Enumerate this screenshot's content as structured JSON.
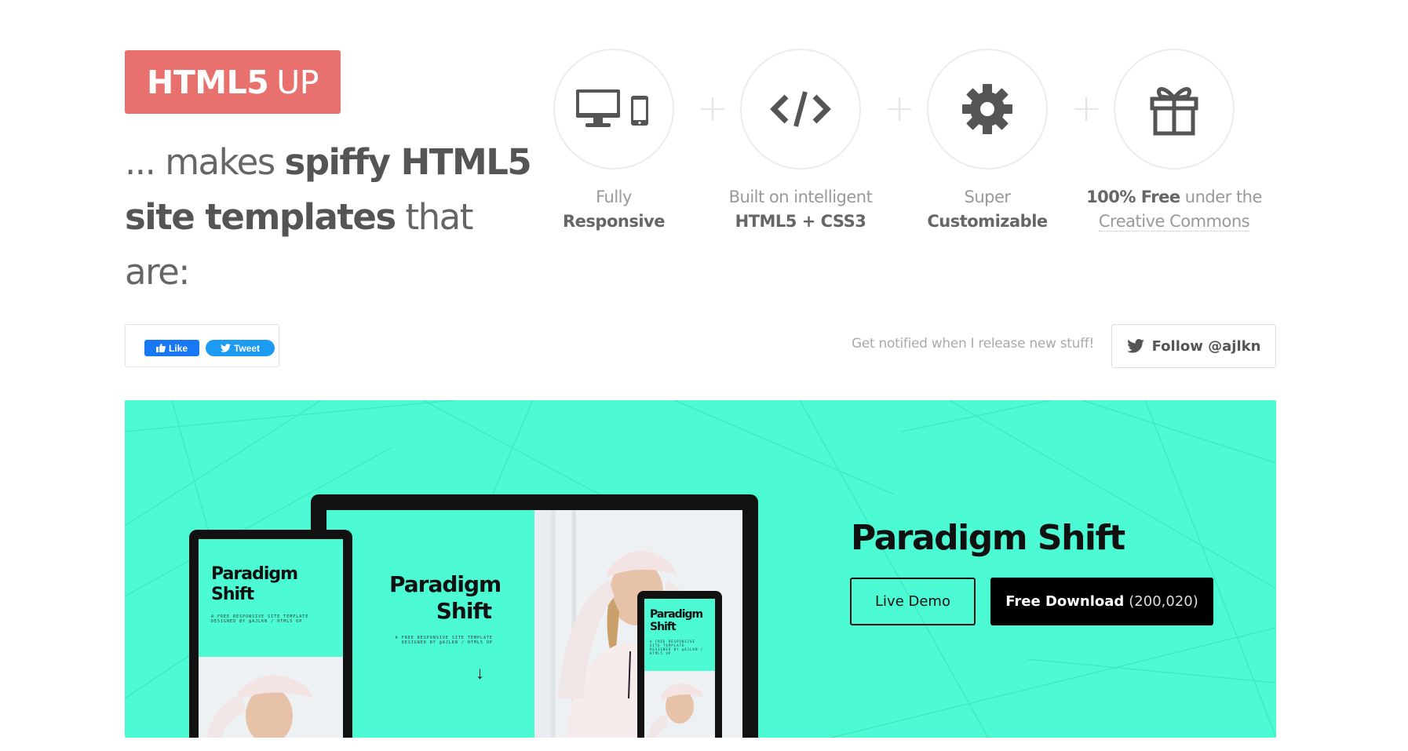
{
  "logo": {
    "bold": "HTML5",
    "light": "UP"
  },
  "tagline": {
    "p1": "... makes ",
    "b1": "spiffy HTML5",
    "b2": "site templates",
    "p2": " that are:"
  },
  "features": [
    {
      "icon": "devices-icon",
      "line1": "Fully",
      "line2": "Responsive"
    },
    {
      "icon": "code-icon",
      "line1": "Built on intelligent",
      "line2": "HTML5 + CSS3"
    },
    {
      "icon": "gear-icon",
      "line1": "Super",
      "line2": "Customizable"
    },
    {
      "icon": "gift-icon",
      "line1_bold": "100% Free",
      "line1_rest": " under the",
      "line2": "Creative Commons"
    }
  ],
  "social": {
    "like_label": "Like",
    "tweet_label": "Tweet"
  },
  "notify_text": "Get notified when I release new stuff!",
  "follow_label": "Follow @ajlkn",
  "banner": {
    "title": "Paradigm Shift",
    "demo_label": "Live Demo",
    "download_label": "Free Download",
    "download_count": "(200,020)",
    "mock_title": "Paradigm Shift",
    "mock_sub": "A FREE RESPONSIVE SITE TEMPLATE DESIGNED BY @AJLKN / HTML5 UP",
    "bg_color": "#4cfbd3"
  }
}
